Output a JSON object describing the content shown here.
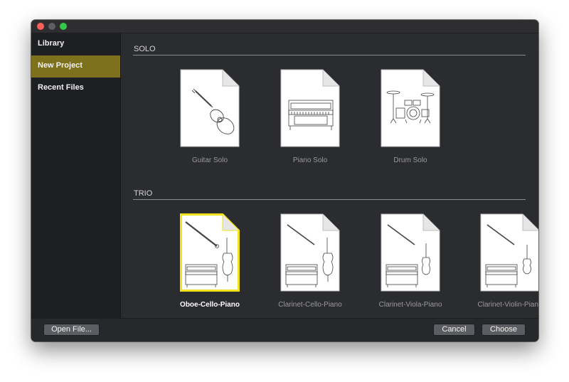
{
  "sidebar": {
    "items": [
      {
        "label": "Library",
        "selected": false
      },
      {
        "label": "New Project",
        "selected": true
      },
      {
        "label": "Recent Files",
        "selected": false
      }
    ]
  },
  "sections": [
    {
      "title": "SOLO",
      "templates": [
        {
          "label": "Guitar Solo",
          "icon": "guitar-icon"
        },
        {
          "label": "Piano Solo",
          "icon": "piano-icon"
        },
        {
          "label": "Drum Solo",
          "icon": "drum-kit-icon"
        }
      ]
    },
    {
      "title": "TRIO",
      "templates": [
        {
          "label": "Oboe-Cello-Piano",
          "icon": "oboe-cello-piano-icon",
          "selected": true
        },
        {
          "label": "Clarinet-Cello-Piano",
          "icon": "clarinet-cello-piano-icon"
        },
        {
          "label": "Clarinet-Viola-Piano",
          "icon": "clarinet-viola-piano-icon"
        },
        {
          "label": "Clarinet-Violin-Piano",
          "icon": "clarinet-violin-piano-icon"
        }
      ]
    }
  ],
  "footer": {
    "open_file_label": "Open File...",
    "cancel_label": "Cancel",
    "choose_label": "Choose"
  },
  "colors": {
    "selection_accent": "#f2e21b",
    "sidebar_selected": "#7d711e"
  }
}
